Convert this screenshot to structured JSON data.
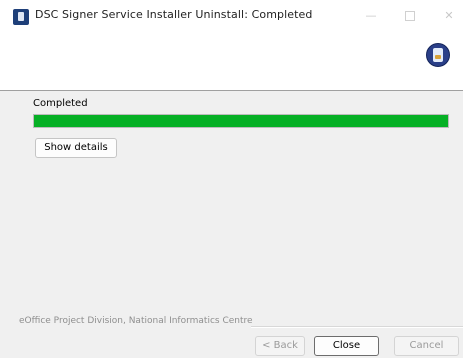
{
  "window": {
    "title": "DSC Signer Service Installer Uninstall: Completed"
  },
  "status": {
    "label": "Completed",
    "progress": 1.0
  },
  "buttons": {
    "show_details": "Show details",
    "back": "< Back",
    "close": "Close",
    "cancel": "Cancel"
  },
  "footer": {
    "branding": "eOffice Project Division, National Informatics Centre"
  },
  "colors": {
    "progress_fill": "#06b025"
  },
  "icons": {
    "app": "installer-app-icon",
    "banner": "installer-banner-icon"
  }
}
